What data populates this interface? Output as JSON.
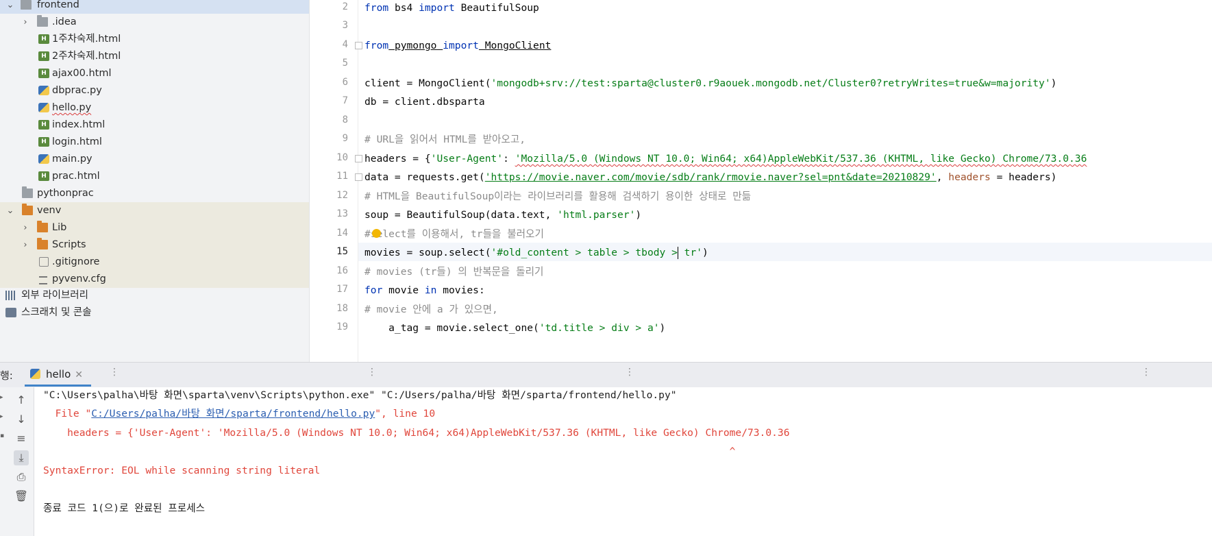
{
  "project_tree": {
    "items": [
      {
        "label": "frontend",
        "type": "folder",
        "expanded": true
      },
      {
        "label": ".idea",
        "type": "folder",
        "expanded": false
      },
      {
        "label": "1주차숙제.html",
        "type": "html"
      },
      {
        "label": "2주차숙제.html",
        "type": "html"
      },
      {
        "label": "ajax00.html",
        "type": "html"
      },
      {
        "label": "dbprac.py",
        "type": "python"
      },
      {
        "label": "hello.py",
        "type": "python"
      },
      {
        "label": "index.html",
        "type": "html"
      },
      {
        "label": "login.html",
        "type": "html"
      },
      {
        "label": "main.py",
        "type": "python"
      },
      {
        "label": "prac.html",
        "type": "html"
      },
      {
        "label": "pythonprac",
        "type": "folder"
      },
      {
        "label": "venv",
        "type": "folder",
        "expanded": true
      },
      {
        "label": "Lib",
        "type": "folder",
        "expanded": false
      },
      {
        "label": "Scripts",
        "type": "folder",
        "expanded": false
      },
      {
        "label": ".gitignore",
        "type": "gitignore"
      },
      {
        "label": "pyvenv.cfg",
        "type": "config"
      },
      {
        "label": "외부 라이브러리",
        "type": "external-libraries"
      },
      {
        "label": "스크래치 및 콘솔",
        "type": "scratches"
      }
    ]
  },
  "editor": {
    "line_numbers": [
      "2",
      "3",
      "4",
      "5",
      "6",
      "7",
      "8",
      "9",
      "10",
      "11",
      "12",
      "13",
      "14",
      "15",
      "16",
      "17",
      "18",
      "19"
    ],
    "current_line": "15",
    "lines": {
      "l2": {
        "kw1": "from",
        "t1": " bs4 ",
        "kw2": "import",
        "t2": " BeautifulSoup"
      },
      "l4": {
        "kw1": "from",
        "t1": " pymongo ",
        "kw2": "import",
        "t2": " MongoClient"
      },
      "l6": {
        "t1": "client = MongoClient(",
        "s1": "'mongodb+srv://test:sparta@cluster0.r9aouek.mongodb.net/Cluster0?retryWrites=true&w=majority'",
        "t2": ")"
      },
      "l7": {
        "t1": "db = client.dbsparta"
      },
      "l9": {
        "c1": "# URL을 읽어서 HTML를 받아오고,"
      },
      "l10": {
        "t1": "headers = {",
        "s1": "'User-Agent'",
        "t2": ": ",
        "s2": "'Mozilla/5.0 (Windows NT 10.0; Win64; x64)AppleWebKit/537.36 (KHTML, like Gecko) Chrome/73.0.36"
      },
      "l11": {
        "t1": "data = requests.get(",
        "s1": "'https://movie.naver.com/movie/sdb/rank/rmovie.naver?sel=pnt&date=20210829'",
        "t2": ", ",
        "k1": "headers",
        "t3": " = headers)"
      },
      "l12": {
        "c1": "# HTML을 BeautifulSoup이라는 라이브러리를 활용해 검색하기 용이한 상태로 만듦"
      },
      "l13": {
        "t1": "soup = BeautifulSoup(data.text, ",
        "s1": "'html.parser'",
        "t2": ")"
      },
      "l14": {
        "c1": "#select를 이용해서, tr들을 불러오기"
      },
      "l15": {
        "t1": "movies = soup.select(",
        "s1": "'#old_content > table > tbody >",
        "s2": " tr'",
        "t2": ")"
      },
      "l16": {
        "c1": "# movies (tr들) 의 반복문을 돌리기"
      },
      "l17": {
        "kw1": "for",
        "t1": " movie ",
        "kw2": "in",
        "t2": " movies:"
      },
      "l18": {
        "c1": "# movie 안에 a 가 있으면,"
      },
      "l19": {
        "t1": "    a_tag = movie.select_one(",
        "s1": "'td.title > div > a'",
        "t2": ")"
      }
    }
  },
  "run_panel": {
    "label": "행:",
    "tab_label": "hello",
    "close_glyph": "✕",
    "console": {
      "cmd": "\"C:\\Users\\palha\\바탕 화면\\sparta\\venv\\Scripts\\python.exe\" \"C:/Users/palha/바탕 화면/sparta/frontend/hello.py\"",
      "file_prefix": "  File \"",
      "file_link": "C:/Users/palha/바탕 화면/sparta/frontend/hello.py",
      "file_suffix": "\", line 10",
      "err_line": "    headers = {'User-Agent': 'Mozilla/5.0 (Windows NT 10.0; Win64; x64)AppleWebKit/537.36 (KHTML, like Gecko) Chrome/73.0.36",
      "caret_line": "                                                                                                                  ^",
      "syntax_error": "SyntaxError: EOL while scanning string literal",
      "exit_msg": "종료 코드 1(으)로 완료된 프로세스"
    }
  },
  "icons": [
    "chevron-down-icon",
    "chevron-right-icon",
    "folder-icon",
    "html-file-icon",
    "python-file-icon",
    "bulb-icon",
    "up-arrow-icon",
    "down-arrow-icon",
    "soft-wrap-icon",
    "scroll-to-end-icon",
    "print-icon",
    "trash-icon",
    "python-icon",
    "close-icon"
  ],
  "colors": {
    "keyword": "#0033b3",
    "string": "#067d17",
    "comment": "#8c8c8c",
    "error": "#e0463b",
    "selection": "#d5e1f2",
    "accent": "#4083c9"
  }
}
